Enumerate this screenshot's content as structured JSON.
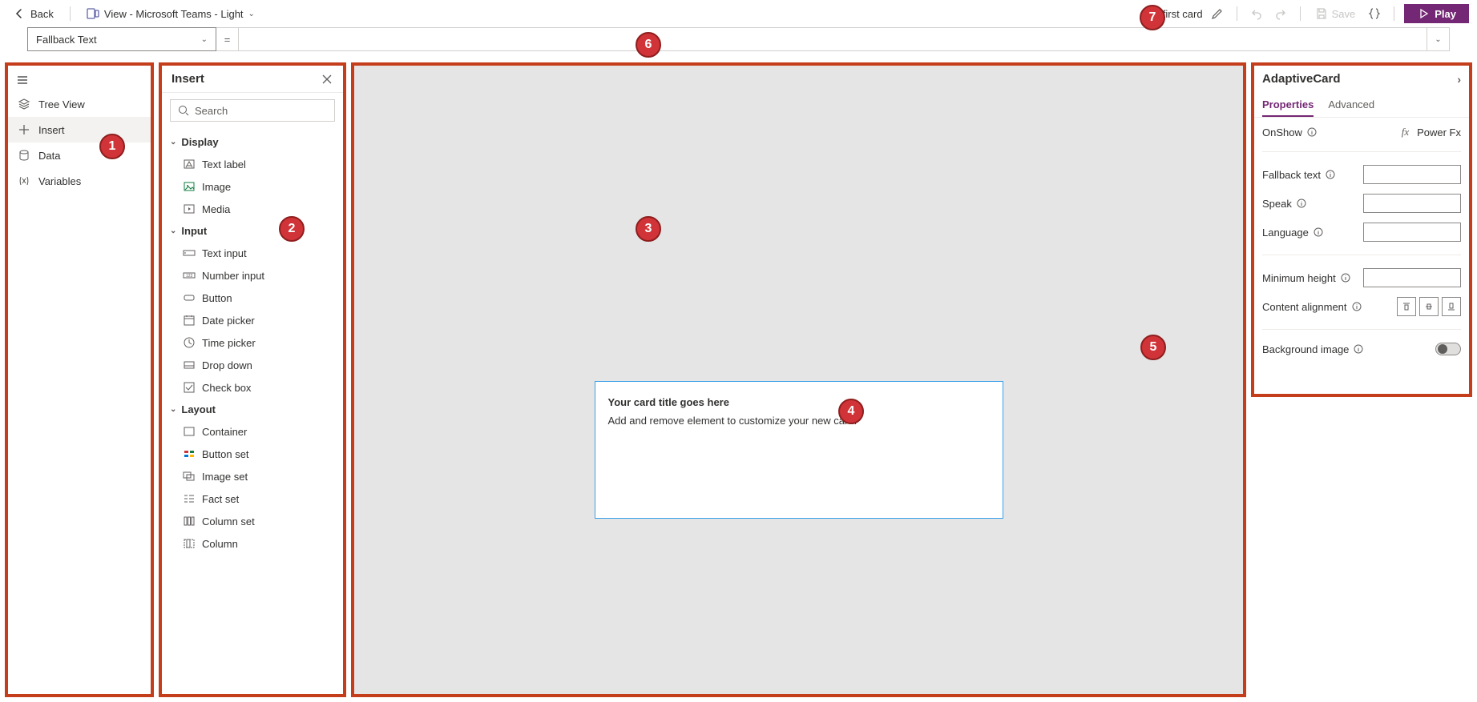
{
  "topbar": {
    "back_label": "Back",
    "view_label": "View - Microsoft Teams - Light",
    "card_name": "My first card",
    "save_label": "Save",
    "play_label": "Play"
  },
  "formula": {
    "property": "Fallback Text"
  },
  "leftnav": {
    "items": [
      {
        "label": "Tree View"
      },
      {
        "label": "Insert"
      },
      {
        "label": "Data"
      },
      {
        "label": "Variables"
      }
    ]
  },
  "insert": {
    "title": "Insert",
    "search_placeholder": "Search",
    "groups": [
      {
        "label": "Display",
        "items": [
          "Text label",
          "Image",
          "Media"
        ]
      },
      {
        "label": "Input",
        "items": [
          "Text input",
          "Number input",
          "Button",
          "Date picker",
          "Time picker",
          "Drop down",
          "Check box"
        ]
      },
      {
        "label": "Layout",
        "items": [
          "Container",
          "Button set",
          "Image set",
          "Fact set",
          "Column set",
          "Column"
        ]
      }
    ]
  },
  "card": {
    "title": "Your card title goes here",
    "subtitle": "Add and remove element to customize your new card."
  },
  "props": {
    "title": "AdaptiveCard",
    "tabs": [
      "Properties",
      "Advanced"
    ],
    "onshow_label": "OnShow",
    "powerfx_label": "Power Fx",
    "rows": [
      "Fallback text",
      "Speak",
      "Language",
      "Minimum height",
      "Content alignment",
      "Background image"
    ]
  },
  "badges": [
    "1",
    "2",
    "3",
    "4",
    "5",
    "6",
    "7"
  ]
}
